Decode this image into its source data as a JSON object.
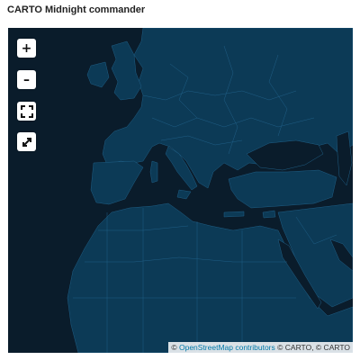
{
  "page_title": "CARTO Midnight commander",
  "colors": {
    "land": "#0c3a56",
    "sea": "#0a1c2b",
    "border": "#1f5f86"
  },
  "controls": {
    "zoom_in": "+",
    "zoom_out": "–",
    "fullscreen_icon": "fullscreen-icon",
    "reset_icon": "expand-arrow-icon"
  },
  "attribution": {
    "symbol": "©",
    "osm_link": "OpenStreetMap contributors",
    "carto_text": "© CARTO, © CARTO"
  }
}
